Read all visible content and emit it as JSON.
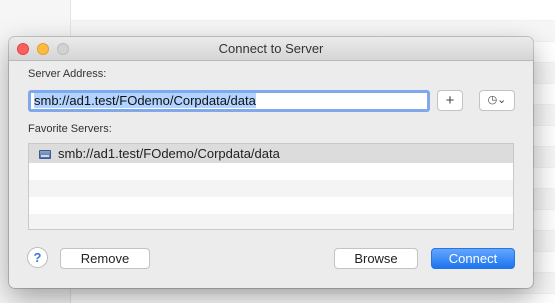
{
  "window": {
    "title": "Connect to Server"
  },
  "server_address": {
    "label": "Server Address:",
    "value": "smb://ad1.test/FOdemo/Corpdata/data"
  },
  "toolbar": {
    "add_symbol": "+",
    "recent_symbol": "◷⌄"
  },
  "favorites": {
    "label": "Favorite Servers:",
    "items": [
      {
        "label": "smb://ad1.test/FOdemo/Corpdata/data",
        "icon": "network-server-icon"
      }
    ]
  },
  "buttons": {
    "help": "?",
    "remove": "Remove",
    "browse": "Browse",
    "connect": "Connect"
  },
  "colors": {
    "accent": "#1c74ee",
    "selection": "#b3d3ff"
  }
}
